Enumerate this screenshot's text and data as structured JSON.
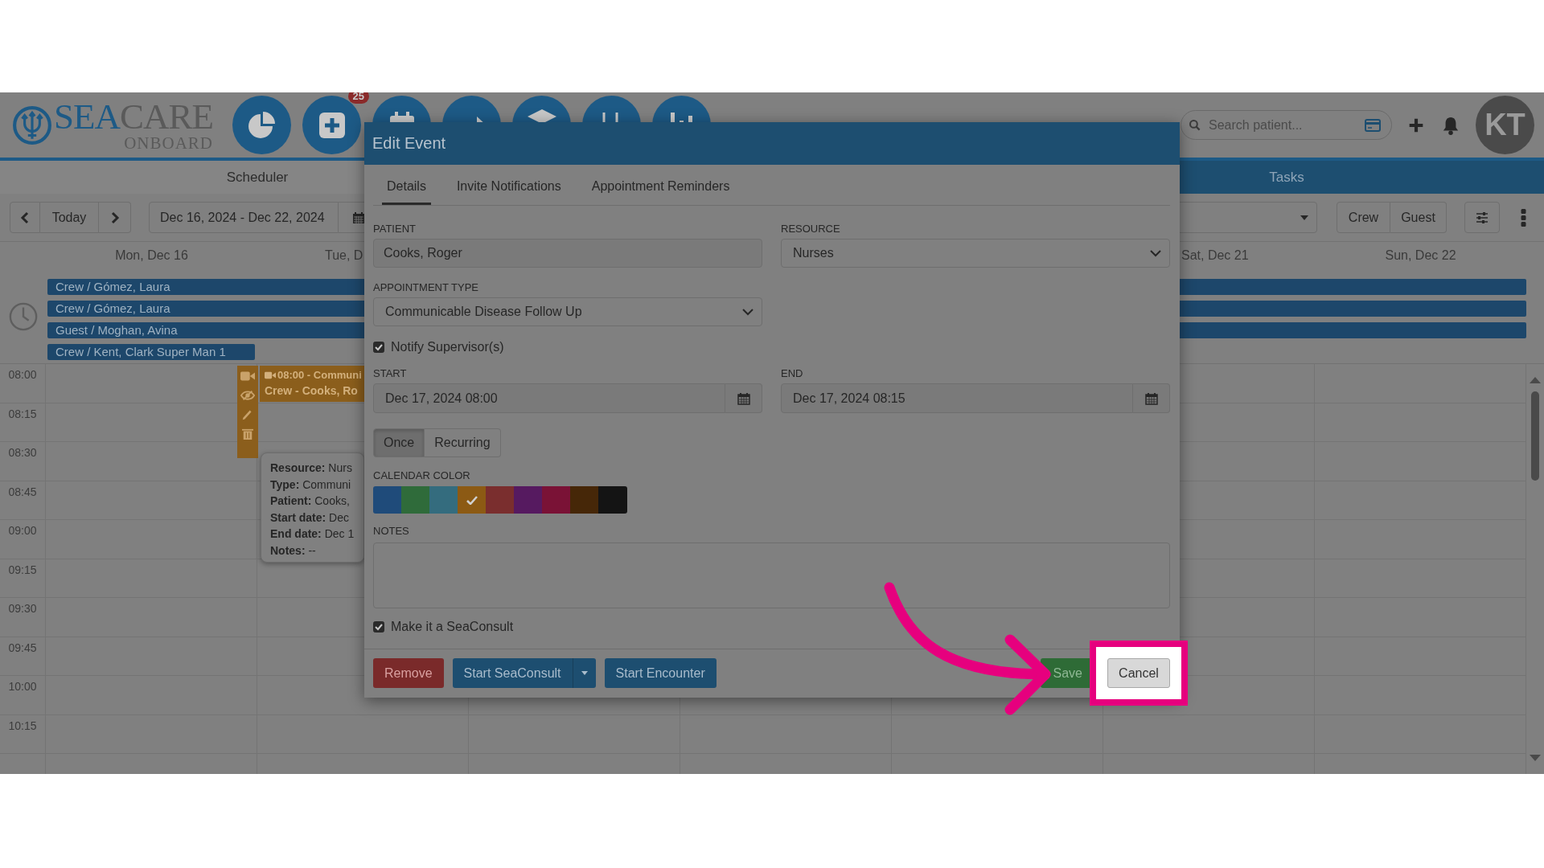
{
  "header": {
    "logo": {
      "wordmark": [
        "SEA",
        "CARE"
      ],
      "tagline": "ONBOARD"
    },
    "nav_buttons": [
      {
        "kind": "pie"
      },
      {
        "kind": "plus",
        "badge": "25"
      },
      {
        "kind": "calendar"
      },
      {
        "kind": "arrow"
      },
      {
        "kind": "box"
      },
      {
        "kind": "stethoscope"
      },
      {
        "kind": "bars"
      }
    ],
    "search": {
      "placeholder": "Search patient..."
    },
    "avatar": {
      "initials": "KT"
    }
  },
  "tabs": [
    {
      "label": "Scheduler",
      "selected": true
    },
    {
      "label": "Tasks",
      "selected": false
    }
  ],
  "toolbar": {
    "today": "Today",
    "date_range": "Dec 16, 2024 - Dec 22, 2024",
    "filters": [
      {
        "label": "Crew"
      },
      {
        "label": "Guest"
      }
    ]
  },
  "day_headers": [
    {
      "label": "Mon, Dec 16"
    },
    {
      "label": "Tue, D"
    },
    {
      "label": "Sat, Dec 21"
    },
    {
      "label": "Sun, Dec 22"
    }
  ],
  "all_day_events": [
    {
      "label": "Crew / Gómez, Laura",
      "all_week": true
    },
    {
      "label": "Crew / Gómez, Laura",
      "all_week": true
    },
    {
      "label": "Guest / Moghan, Avina",
      "all_week": true
    },
    {
      "label": "Crew / Kent, Clark Super Man 1",
      "all_week": false
    }
  ],
  "time_slots": [
    "08:00",
    "08:15",
    "08:30",
    "08:45",
    "09:00",
    "09:15",
    "09:30",
    "09:45",
    "10:00",
    "10:15"
  ],
  "event": {
    "title": "08:00 - Communi",
    "subtitle": "Crew - Cooks, Ro",
    "details": [
      "**Resource:** Nurs",
      "**Type:** Communi",
      "**Patient:** Cooks,",
      "**Start date:** Dec",
      "**End date:** Dec 1",
      "**Notes:** --"
    ]
  },
  "modal": {
    "title": "Edit Event",
    "tabs": [
      {
        "label": "Details",
        "selected": true
      },
      {
        "label": "Invite Notifications",
        "selected": false
      },
      {
        "label": "Appointment Reminders",
        "selected": false
      }
    ],
    "patient": {
      "label": "PATIENT",
      "value": "Cooks, Roger"
    },
    "resource": {
      "label": "RESOURCE",
      "value": "Nurses"
    },
    "appointment_type": {
      "label": "APPOINTMENT TYPE",
      "value": "Communicable Disease Follow Up"
    },
    "notify": {
      "label": "Notify Supervisor(s)",
      "checked": true
    },
    "start": {
      "label": "START",
      "value": "Dec 17, 2024 08:00"
    },
    "end": {
      "label": "END",
      "value": "Dec 17, 2024 08:15"
    },
    "repeat": [
      {
        "label": "Once",
        "selected": true
      },
      {
        "label": "Recurring",
        "selected": false
      }
    ],
    "calendar_color": {
      "label": "CALENDAR COLOR",
      "swatches": [
        {
          "color": "#1f4b7a",
          "selected": false
        },
        {
          "color": "#2f6b3a",
          "selected": false
        },
        {
          "color": "#346c7e",
          "selected": false
        },
        {
          "color": "#8c5a14",
          "selected": true
        },
        {
          "color": "#7a2e2e",
          "selected": false
        },
        {
          "color": "#561a60",
          "selected": false
        },
        {
          "color": "#7a1236",
          "selected": false
        },
        {
          "color": "#462708",
          "selected": false
        },
        {
          "color": "#141414",
          "selected": false
        }
      ]
    },
    "notes": {
      "label": "NOTES"
    },
    "seaconsult": {
      "label": "Make it a SeaConsult",
      "checked": true
    },
    "buttons": [
      {
        "label": "Remove",
        "kind": "danger"
      },
      {
        "label": "Start SeaConsult",
        "kind": "split"
      },
      {
        "label": "Start Encounter",
        "kind": "primary"
      },
      {
        "label": "Save",
        "kind": "success"
      },
      {
        "label": "Cancel",
        "kind": "default",
        "highlighted": true
      }
    ]
  }
}
